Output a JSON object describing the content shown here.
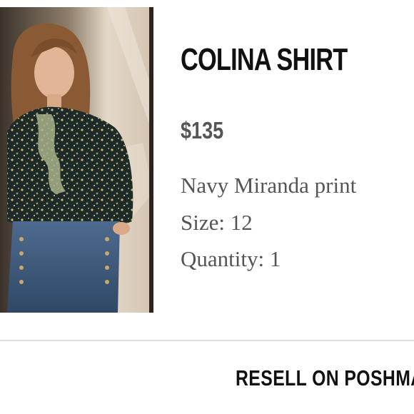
{
  "product": {
    "image_alt": "Model wearing the Colina Shirt in a navy floral print with high-waisted denim",
    "name": "COLINA SHIRT",
    "price": "$135",
    "print": "Navy Miranda print",
    "size": "Size: 12",
    "quantity": "Quantity: 1"
  },
  "actions": {
    "resell_label": "RESELL ON POSHMARK"
  },
  "colors": {
    "title": "#111111",
    "secondary_text": "#555555",
    "divider": "#dedede",
    "background": "#ffffff"
  }
}
